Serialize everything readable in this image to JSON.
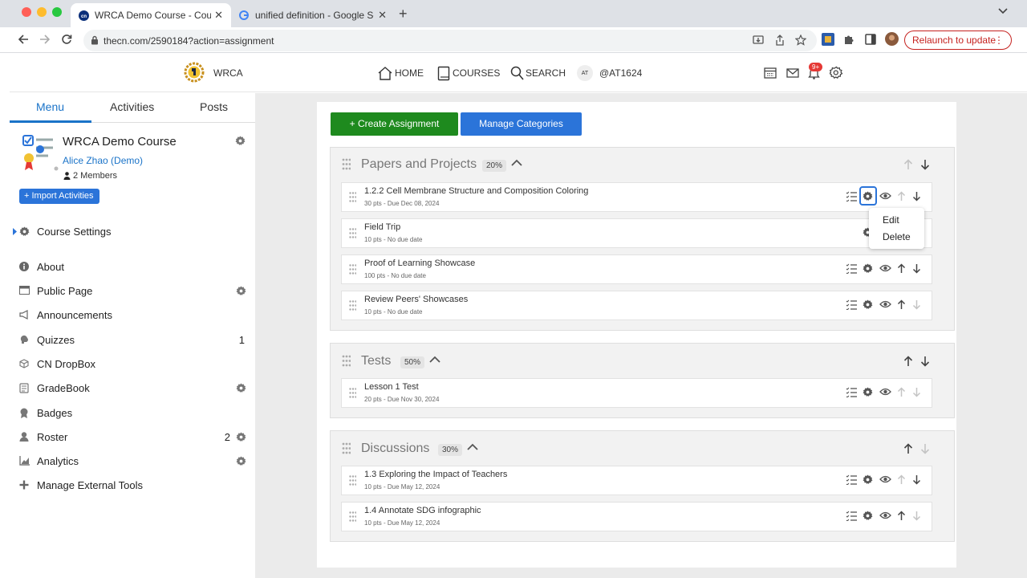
{
  "browser": {
    "tabs": [
      {
        "title": "WRCA Demo Course - Course",
        "active": true
      },
      {
        "title": "unified definition - Google Sea",
        "active": false
      }
    ],
    "url": "thecn.com/2590184?action=assignment",
    "relaunch_label": "Relaunch to update"
  },
  "header": {
    "logo_text": "WRCA",
    "nav": {
      "home": "HOME",
      "courses": "COURSES",
      "search": "SEARCH"
    },
    "user_initials": "AT",
    "user_handle": "@AT1624",
    "notification_badge": "9+"
  },
  "sidebar": {
    "tabs": [
      "Menu",
      "Activities",
      "Posts"
    ],
    "course_title": "WRCA Demo Course",
    "instructor": "Alice Zhao (Demo)",
    "members": "2 Members",
    "import_label": "+ Import Activities",
    "items": [
      {
        "label": "Course Settings",
        "icon": "gear-icon"
      },
      {
        "label": "About",
        "icon": "info-icon"
      },
      {
        "label": "Public Page",
        "icon": "browser-icon",
        "gear": true
      },
      {
        "label": "Announcements",
        "icon": "megaphone-icon"
      },
      {
        "label": "Quizzes",
        "icon": "brain-icon",
        "badge": "1"
      },
      {
        "label": "CN DropBox",
        "icon": "cube-icon"
      },
      {
        "label": "GradeBook",
        "icon": "gradebook-icon",
        "gear": true
      },
      {
        "label": "Badges",
        "icon": "badge-icon"
      },
      {
        "label": "Roster",
        "icon": "person-icon",
        "badge": "2",
        "gear": true
      },
      {
        "label": "Analytics",
        "icon": "chart-icon",
        "gear": true
      },
      {
        "label": "Manage External Tools",
        "icon": "plus-icon"
      }
    ]
  },
  "main": {
    "create_label": "+ Create Assignment",
    "manage_label": "Manage Categories",
    "categories": [
      {
        "title": "Papers and Projects",
        "pct": "20%",
        "items": [
          {
            "title": "1.2.2 Cell Membrane Structure and Composition Coloring",
            "meta": "30 pts - Due Dec 08, 2024"
          },
          {
            "title": "Field Trip",
            "meta": "10 pts - No due date"
          },
          {
            "title": "Proof of Learning Showcase",
            "meta": "100 pts - No due date"
          },
          {
            "title": "Review Peers' Showcases",
            "meta": "10 pts - No due date"
          }
        ]
      },
      {
        "title": "Tests",
        "pct": "50%",
        "items": [
          {
            "title": "Lesson 1 Test",
            "meta": "20 pts - Due Nov 30, 2024"
          }
        ]
      },
      {
        "title": "Discussions",
        "pct": "30%",
        "items": [
          {
            "title": "1.3 Exploring the Impact of Teachers",
            "meta": "10 pts - Due May 12, 2024"
          },
          {
            "title": "1.4 Annotate SDG infographic",
            "meta": "10 pts - Due May 12, 2024"
          }
        ]
      }
    ],
    "context_menu": {
      "edit": "Edit",
      "delete": "Delete"
    }
  },
  "colors": {
    "accent": "#1a73c8",
    "create": "#1e8a1e",
    "manage": "#2b74d9",
    "notify": "#e53935",
    "relaunch": "#c5221f"
  }
}
